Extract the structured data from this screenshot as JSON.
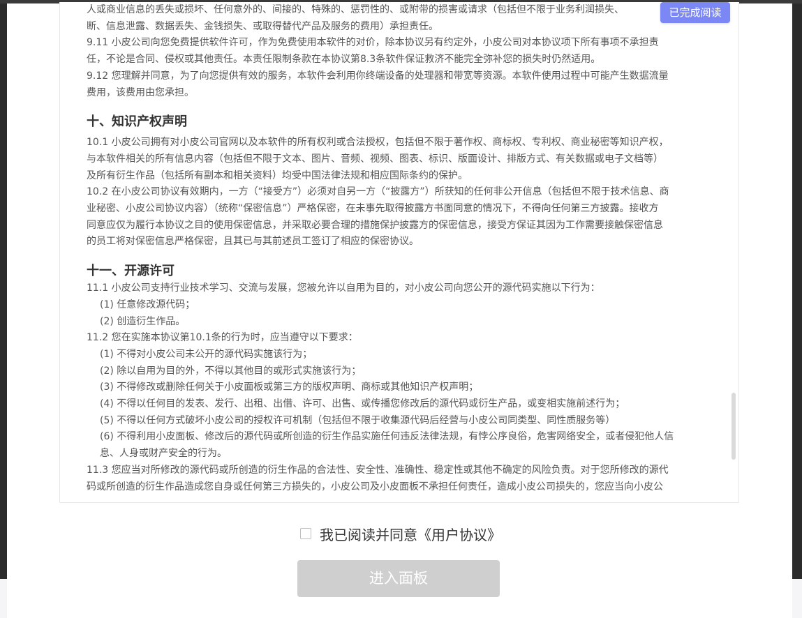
{
  "agreement": {
    "lines_top": [
      "人或商业信息的丢失或损坏、任何意外的、间接的、特殊的、惩罚性的、或附带的损害或请求（包括但不限于业务利润损失、",
      "断、信息泄露、数据丢失、金钱损失、或取得替代产品及服务的费用）承担责任。",
      "9.11 小皮公司向您免费提供软件许可，作为免费使用本软件的对价，除本协议另有约定外，小皮公司对本协议项下所有事项不承担责",
      "任，不论是合同、侵权或其他责任。本责任限制条款在本协议第8.3条软件保证救济不能完全弥补您的损失时仍然适用。",
      "9.12 您理解并同意，为了向您提供有效的服务，本软件会利用你终端设备的处理器和带宽等资源。本软件使用过程中可能产生数据流量",
      "费用，该费用由您承担。"
    ],
    "section10_title": "十、知识产权声明",
    "section10_lines": [
      "10.1 小皮公司拥有对小皮公司官网以及本软件的所有权利或合法授权，包括但不限于著作权、商标权、专利权、商业秘密等知识产权，",
      "与本软件相关的所有信息内容（包括但不限于文本、图片、音频、视频、图表、标识、版面设计、排版方式、有关数据或电子文档等）",
      "及所有衍生作品（包括所有副本和相关资料）均受中国法律法规和相应国际条约的保护。",
      "10.2 在小皮公司协议有效期内，一方（“接受方”）必须对自另一方（“披露方”）所获知的任何非公开信息（包括但不限于技术信息、商",
      "业秘密、小皮公司协议内容）（统称“保密信息”）严格保密，在未事先取得披露方书面同意的情况下，不得向任何第三方披露。接收方",
      "同意应仅为履行本协议之目的使用保密信息，并采取必要合理的措施保护披露方的保密信息，接受方保证其因为工作需要接触保密信息",
      "的员工将对保密信息严格保密，且其已与其前述员工签订了相应的保密协议。"
    ],
    "section11_title": "十一、开源许可",
    "section11_lines": [
      {
        "text": "11.1 小皮公司支持行业技术学习、交流与发展，您被允许以自用为目的，对小皮公司向您公开的源代码实施以下行为：",
        "indent": false
      },
      {
        "text": "(1) 任意修改源代码；",
        "indent": true
      },
      {
        "text": "(2) 创造衍生作品。",
        "indent": true
      },
      {
        "text": "11.2 您在实施本协议第10.1条的行为时，应当遵守以下要求：",
        "indent": false
      },
      {
        "text": "(1) 不得对小皮公司未公开的源代码实施该行为；",
        "indent": true
      },
      {
        "text": "(2) 除以自用为目的外，不得以其他目的或形式实施该行为；",
        "indent": true
      },
      {
        "text": "(3) 不得修改或删除任何关于小皮面板或第三方的版权声明、商标或其他知识产权声明；",
        "indent": true
      },
      {
        "text": "(4) 不得以任何目的发表、发行、出租、出借、许可、出售、或传播您修改后的源代码或衍生产品，或变相实施前述行为；",
        "indent": true
      },
      {
        "text": "(5) 不得以任何方式破坏小皮公司的授权许可机制（包括但不限于收集源代码后经营与小皮公司同类型、同性质服务等）",
        "indent": true
      },
      {
        "text": "(6) 不得利用小皮面板、修改后的源代码或所创造的衍生作品实施任何违反法律法规，有悖公序良俗，危害网络安全，或者侵犯他人信",
        "indent": true
      },
      {
        "text": "息、人身或财产安全的行为。",
        "indent": true
      },
      {
        "text": "11.3 您应当对所修改的源代码或所创造的衍生作品的合法性、安全性、准确性、稳定性或其他不确定的风险负责。对于您所修改的源代",
        "indent": false
      },
      {
        "text": "码或所创造的衍生作品造成您自身或任何第三方损失的，小皮公司及小皮面板不承担任何责任，造成小皮公司损失的，您应当向小皮公",
        "indent": false
      }
    ]
  },
  "badge": {
    "label": "已完成阅读"
  },
  "agree": {
    "label": "我已阅读并同意《用户协议》",
    "checked": false
  },
  "enter_button": {
    "label": "进入面板",
    "enabled": false
  },
  "colors": {
    "badge_bg": "#7b87f5",
    "button_disabled": "#cfcfcf"
  }
}
